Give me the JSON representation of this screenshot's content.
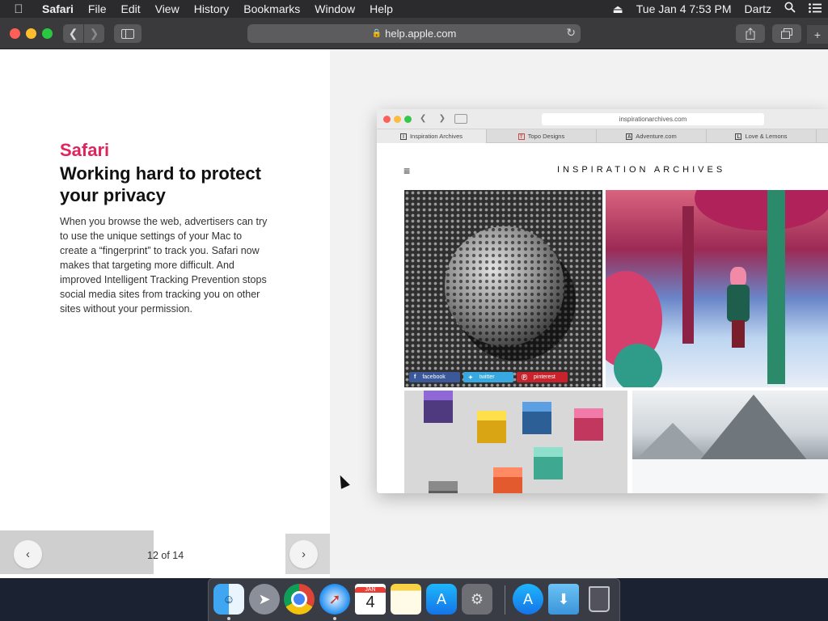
{
  "menubar": {
    "app": "Safari",
    "items": [
      "File",
      "Edit",
      "View",
      "History",
      "Bookmarks",
      "Window",
      "Help"
    ],
    "datetime": "Tue Jan 4  7:53 PM",
    "user": "Dartz"
  },
  "toolbar": {
    "url": "help.apple.com"
  },
  "page": {
    "app_name": "Safari",
    "headline": "Working hard to protect your privacy",
    "body": "When you browse the web, advertisers can try to use the unique settings of your Mac to create a “fingerprint” to track you. Safari now makes that targeting more difficult. And improved Intelligent Tracking Prevention stops social media sites from tracking you on other sites without your permission.",
    "pager": {
      "count": "12 of 14",
      "prev_icon": "chevron-left-icon",
      "next_icon": "chevron-right-icon"
    }
  },
  "mini_browser": {
    "url": "inspirationarchives.com",
    "tabs": [
      {
        "label": "Inspiration Archives",
        "favicon": "I"
      },
      {
        "label": "Topo Designs",
        "favicon": "T"
      },
      {
        "label": "Adventure.com",
        "favicon": "A"
      },
      {
        "label": "Love & Lemons",
        "favicon": "L"
      }
    ],
    "site_title": "INSPIRATION ARCHIVES",
    "social": {
      "facebook": "facebook",
      "twitter": "twitter",
      "pinterest": "pinterest"
    }
  },
  "dock": {
    "calendar_month": "JAN",
    "calendar_day": "4",
    "apps": [
      "finder-icon",
      "launchpad-icon",
      "chrome-icon",
      "safari-icon",
      "calendar-icon",
      "notes-icon",
      "app-store-icon",
      "system-preferences-icon",
      "app-store-icon",
      "downloads-folder-icon",
      "trash-icon"
    ]
  },
  "colors": {
    "accent_pink": "#e0245e",
    "facebook": "#3b5998",
    "twitter": "#37a8e0",
    "pinterest": "#c8232c"
  }
}
